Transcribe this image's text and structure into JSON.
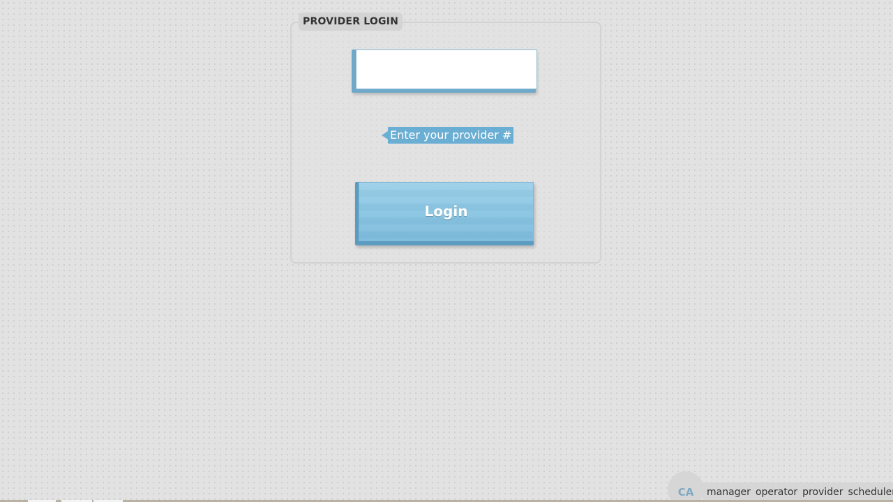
{
  "login_form": {
    "title": "PROVIDER LOGIN",
    "provider_input": {
      "value": "",
      "placeholder": ""
    },
    "hint": "Enter your provider #",
    "login_button_label": "Login"
  },
  "footer": {
    "badge": "CA",
    "nav_links": [
      "manager",
      "operator",
      "provider",
      "scheduler"
    ]
  },
  "colors": {
    "accent": "#6aaed3",
    "button": "#8ac6e3",
    "background": "#e2e2e2"
  }
}
